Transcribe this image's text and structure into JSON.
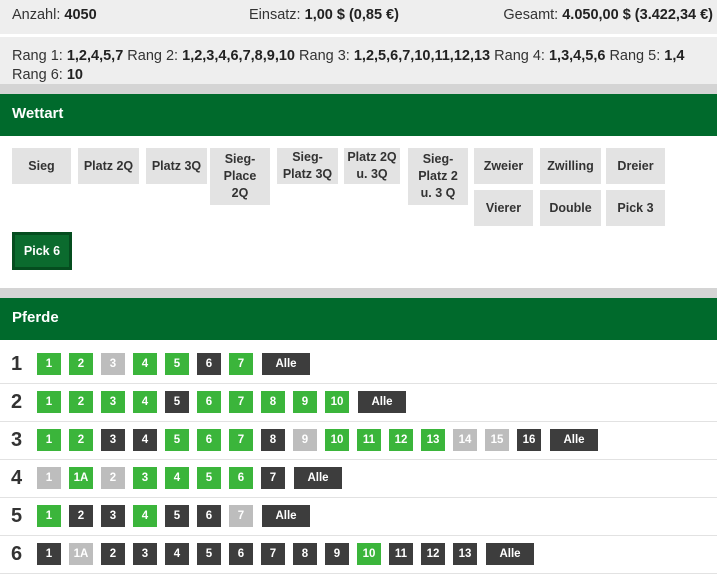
{
  "summary": {
    "anzahl_label": "Anzahl:",
    "anzahl_value": "4050",
    "einsatz_label": "Einsatz:",
    "einsatz_value": "1,00 $ (0,85 €)",
    "gesamt_label": "Gesamt:",
    "gesamt_value": "4.050,00 $ (3.422,34 €)"
  },
  "ranks": [
    {
      "label": "Rang 1:",
      "value": "1,2,4,5,7"
    },
    {
      "label": "Rang 2:",
      "value": "1,2,3,4,6,7,8,9,10"
    },
    {
      "label": "Rang 3:",
      "value": "1,2,5,6,7,10,11,12,13"
    },
    {
      "label": "Rang 4:",
      "value": "1,3,4,5,6"
    },
    {
      "label": "Rang 5:",
      "value": "1,4"
    },
    {
      "label": "Rang 6:",
      "value": "10"
    }
  ],
  "wettart": {
    "title": "Wettart",
    "buttons": [
      {
        "label": "Sieg",
        "active": false
      },
      {
        "label": "Platz 2Q",
        "active": false
      },
      {
        "label": "Platz 3Q",
        "active": false
      },
      {
        "label": "Sieg-\nPlace\n2Q",
        "active": false
      },
      {
        "label": "Sieg-\nPlatz 3Q",
        "active": false
      },
      {
        "label": "Platz 2Q\nu. 3Q",
        "active": false
      },
      {
        "label": "Sieg-\nPlatz 2\nu. 3 Q",
        "active": false
      },
      {
        "label": "Zweier",
        "active": false
      },
      {
        "label": "Zwilling",
        "active": false
      },
      {
        "label": "Dreier",
        "active": false
      },
      {
        "label": "Vierer",
        "active": false
      },
      {
        "label": "Double",
        "active": false
      },
      {
        "label": "Pick 3",
        "active": false
      },
      {
        "label": "Pick 6",
        "active": true
      }
    ]
  },
  "pferde": {
    "title": "Pferde",
    "all_label": "Alle",
    "rows": [
      {
        "rank": "1",
        "horses": [
          {
            "n": "1",
            "state": "selected"
          },
          {
            "n": "2",
            "state": "selected"
          },
          {
            "n": "3",
            "state": "disabled"
          },
          {
            "n": "4",
            "state": "selected"
          },
          {
            "n": "5",
            "state": "selected"
          },
          {
            "n": "6",
            "state": "unselected"
          },
          {
            "n": "7",
            "state": "selected"
          }
        ]
      },
      {
        "rank": "2",
        "horses": [
          {
            "n": "1",
            "state": "selected"
          },
          {
            "n": "2",
            "state": "selected"
          },
          {
            "n": "3",
            "state": "selected"
          },
          {
            "n": "4",
            "state": "selected"
          },
          {
            "n": "5",
            "state": "unselected"
          },
          {
            "n": "6",
            "state": "selected"
          },
          {
            "n": "7",
            "state": "selected"
          },
          {
            "n": "8",
            "state": "selected"
          },
          {
            "n": "9",
            "state": "selected"
          },
          {
            "n": "10",
            "state": "selected"
          }
        ]
      },
      {
        "rank": "3",
        "horses": [
          {
            "n": "1",
            "state": "selected"
          },
          {
            "n": "2",
            "state": "selected"
          },
          {
            "n": "3",
            "state": "unselected"
          },
          {
            "n": "4",
            "state": "unselected"
          },
          {
            "n": "5",
            "state": "selected"
          },
          {
            "n": "6",
            "state": "selected"
          },
          {
            "n": "7",
            "state": "selected"
          },
          {
            "n": "8",
            "state": "unselected"
          },
          {
            "n": "9",
            "state": "disabled"
          },
          {
            "n": "10",
            "state": "selected"
          },
          {
            "n": "11",
            "state": "selected"
          },
          {
            "n": "12",
            "state": "selected"
          },
          {
            "n": "13",
            "state": "selected"
          },
          {
            "n": "14",
            "state": "disabled"
          },
          {
            "n": "15",
            "state": "disabled"
          },
          {
            "n": "16",
            "state": "unselected"
          }
        ]
      },
      {
        "rank": "4",
        "horses": [
          {
            "n": "1",
            "state": "disabled"
          },
          {
            "n": "1A",
            "state": "selected"
          },
          {
            "n": "2",
            "state": "disabled"
          },
          {
            "n": "3",
            "state": "selected"
          },
          {
            "n": "4",
            "state": "selected"
          },
          {
            "n": "5",
            "state": "selected"
          },
          {
            "n": "6",
            "state": "selected"
          },
          {
            "n": "7",
            "state": "unselected"
          }
        ]
      },
      {
        "rank": "5",
        "horses": [
          {
            "n": "1",
            "state": "selected"
          },
          {
            "n": "2",
            "state": "unselected"
          },
          {
            "n": "3",
            "state": "unselected"
          },
          {
            "n": "4",
            "state": "selected"
          },
          {
            "n": "5",
            "state": "unselected"
          },
          {
            "n": "6",
            "state": "unselected"
          },
          {
            "n": "7",
            "state": "disabled"
          }
        ]
      },
      {
        "rank": "6",
        "horses": [
          {
            "n": "1",
            "state": "unselected"
          },
          {
            "n": "1A",
            "state": "disabled"
          },
          {
            "n": "2",
            "state": "unselected"
          },
          {
            "n": "3",
            "state": "unselected"
          },
          {
            "n": "4",
            "state": "unselected"
          },
          {
            "n": "5",
            "state": "unselected"
          },
          {
            "n": "6",
            "state": "unselected"
          },
          {
            "n": "7",
            "state": "unselected"
          },
          {
            "n": "8",
            "state": "unselected"
          },
          {
            "n": "9",
            "state": "unselected"
          },
          {
            "n": "10",
            "state": "selected"
          },
          {
            "n": "11",
            "state": "unselected"
          },
          {
            "n": "12",
            "state": "unselected"
          },
          {
            "n": "13",
            "state": "unselected"
          }
        ]
      }
    ]
  },
  "colors": {
    "header_green": "#006a2c",
    "selected_green": "#3bb53b",
    "unselected_dark": "#3d3d3d",
    "disabled_grey": "#bdbdbd"
  }
}
